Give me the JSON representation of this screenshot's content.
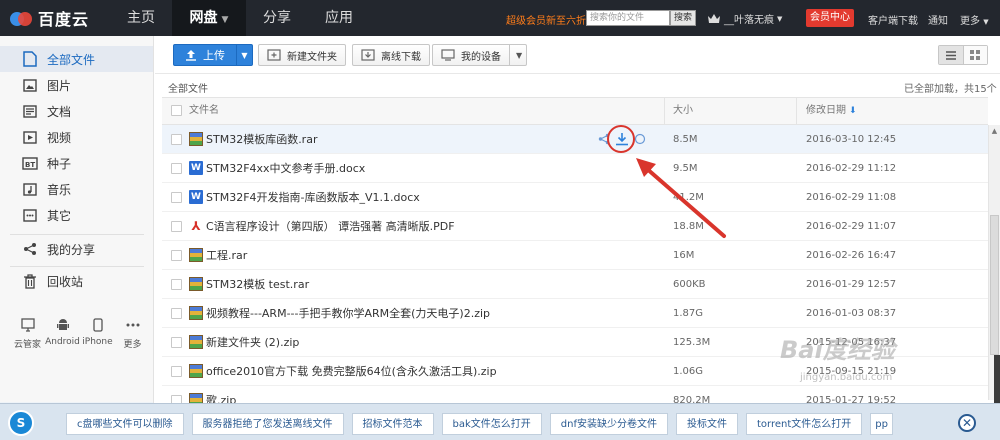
{
  "topbar": {
    "logo_text": "百度云",
    "nav": [
      {
        "label": "主页"
      },
      {
        "label": "网盘",
        "active": true
      },
      {
        "label": "分享"
      },
      {
        "label": "应用"
      }
    ],
    "vip_promo": "超级会员新至六折",
    "search_placeholder": "搜索你的文件",
    "search_button": "搜索",
    "username": "__叶落无痕",
    "vip_center": "会员中心",
    "client_download": "客户端下载",
    "notify": "通知",
    "more": "更多"
  },
  "sidebar": {
    "items": [
      {
        "label": "全部文件",
        "icon": "file-icon"
      },
      {
        "label": "图片",
        "icon": "image-icon"
      },
      {
        "label": "文档",
        "icon": "document-icon"
      },
      {
        "label": "视频",
        "icon": "video-icon"
      },
      {
        "label": "种子",
        "icon": "bt-icon"
      },
      {
        "label": "音乐",
        "icon": "music-icon"
      },
      {
        "label": "其它",
        "icon": "other-icon"
      },
      {
        "label": "我的分享",
        "icon": "share-icon"
      },
      {
        "label": "回收站",
        "icon": "trash-icon"
      }
    ],
    "devices": [
      {
        "label": "云管家",
        "icon": "monitor-icon"
      },
      {
        "label": "Android",
        "icon": "android-icon"
      },
      {
        "label": "iPhone",
        "icon": "iphone-icon"
      },
      {
        "label": "更多",
        "icon": "more-dots-icon"
      }
    ]
  },
  "toolbar": {
    "upload": "上传",
    "new_folder": "新建文件夹",
    "offline_download": "离线下载",
    "my_devices": "我的设备"
  },
  "breadcrumb": "全部文件",
  "loaded_status": "已全部加载，共15个",
  "table": {
    "headers": {
      "name": "文件名",
      "size": "大小",
      "date": "修改日期"
    },
    "rows": [
      {
        "name": "STM32模板库函数.rar",
        "type": "rar",
        "size": "8.5M",
        "date": "2016-03-10 12:45"
      },
      {
        "name": "STM32F4xx中文参考手册.docx",
        "type": "doc",
        "size": "9.5M",
        "date": "2016-02-29 11:12"
      },
      {
        "name": "STM32F4开发指南-库函数版本_V1.1.docx",
        "type": "doc",
        "size": "41.2M",
        "date": "2016-02-29 11:08"
      },
      {
        "name": "C语言程序设计（第四版） 谭浩强著 高清晰版.PDF",
        "type": "pdf",
        "size": "18.8M",
        "date": "2016-02-29 11:07"
      },
      {
        "name": "工程.rar",
        "type": "rar",
        "size": "16M",
        "date": "2016-02-26 16:47"
      },
      {
        "name": "STM32模板 test.rar",
        "type": "rar",
        "size": "600KB",
        "date": "2016-01-29 12:57"
      },
      {
        "name": "视频教程---ARM---手把手教你学ARM全套(力天电子)2.zip",
        "type": "rar",
        "size": "1.87G",
        "date": "2016-01-03 08:37"
      },
      {
        "name": "新建文件夹 (2).zip",
        "type": "rar",
        "size": "125.3M",
        "date": "2015-12-05 16:37"
      },
      {
        "name": "office2010官方下载 免费完整版64位(含永久激活工具).zip",
        "type": "rar",
        "size": "1.06G",
        "date": "2015-09-15 21:19"
      },
      {
        "name": "歌.zip",
        "type": "rar",
        "size": "820.2M",
        "date": "2015-01-27 19:52"
      }
    ]
  },
  "bottom_bar": {
    "items": [
      "c盘哪些文件可以删除",
      "服务器拒绝了您发送离线文件",
      "招标文件范本",
      "bak文件怎么打开",
      "dnf安装缺少分卷文件",
      "投标文件",
      "torrent文件怎么打开",
      "pp"
    ]
  },
  "watermark": {
    "main": "Bai度经验",
    "sub": "jingyan.baidu.com"
  },
  "colors": {
    "topbar": "#23272e",
    "accent": "#2e82db",
    "vip": "#e33a2f",
    "annotation": "#d9352c"
  }
}
